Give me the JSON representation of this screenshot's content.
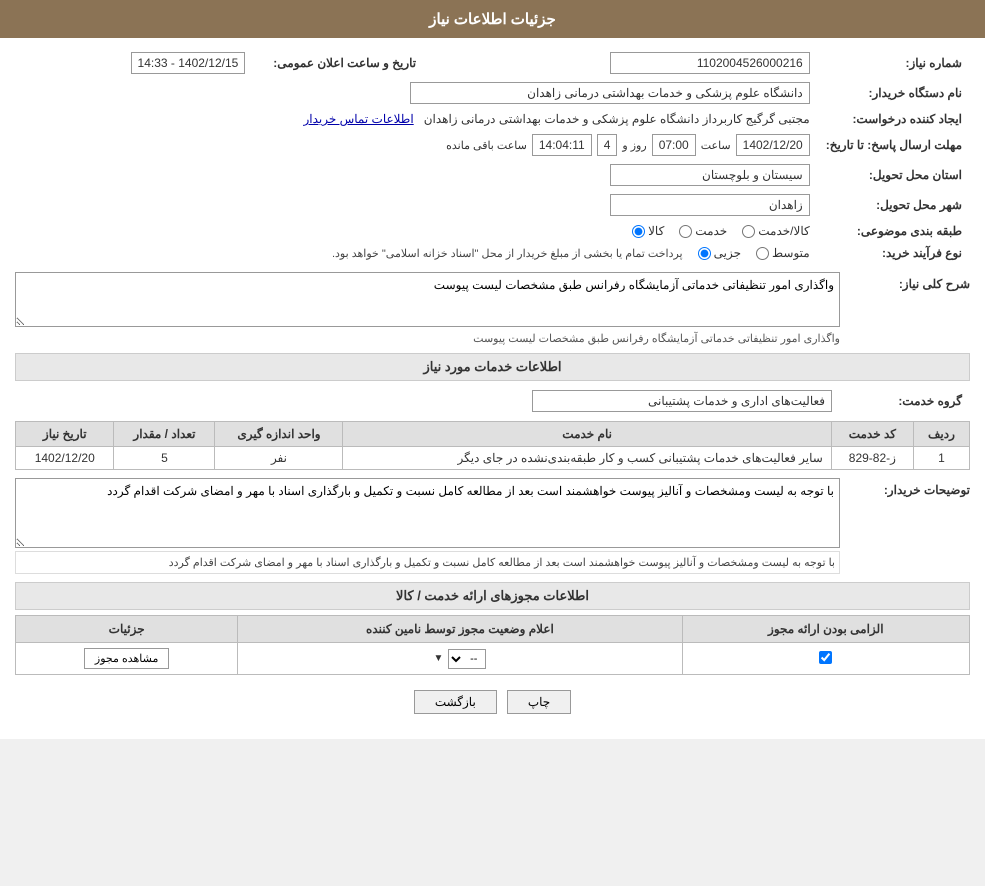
{
  "header": {
    "title": "جزئیات اطلاعات نیاز"
  },
  "labels": {
    "need_number": "شماره نیاز:",
    "buyer_org": "نام دستگاه خریدار:",
    "creator": "ایجاد کننده درخواست:",
    "send_date": "مهلت ارسال پاسخ: تا تاریخ:",
    "province": "استان محل تحویل:",
    "city": "شهر محل تحویل:",
    "category": "طبقه بندی موضوعی:",
    "purchase_type": "نوع فرآیند خرید:",
    "general_desc": "شرح کلی نیاز:",
    "service_info": "اطلاعات خدمات مورد نیاز",
    "service_group": "گروه خدمت:",
    "buyer_notes": "توضیحات خریدار:",
    "permissions_info": "اطلاعات مجوزهای ارائه خدمت / کالا",
    "announce_date": "تاریخ و ساعت اعلان عمومی:",
    "mandatory_permit": "الزامی بودن ارائه مجوز",
    "permit_status": "اعلام وضعیت مجوز توسط نامین کننده",
    "details": "جزئیات"
  },
  "values": {
    "need_number": "1102004526000216",
    "announce_date": "1402/12/15 - 14:33",
    "buyer_org": "دانشگاه علوم پزشکی و خدمات بهداشتی درمانی زاهدان",
    "creator_name": "مجتبی گرگیج کاربرداز دانشگاه علوم پزشکی و خدمات بهداشتی درمانی زاهدان",
    "creator_link": "اطلاعات تماس خریدار",
    "deadline_date": "1402/12/20",
    "deadline_time": "07:00",
    "deadline_days": "4",
    "deadline_remaining": "14:04:11",
    "province": "سیستان و بلوچستان",
    "city": "زاهدان",
    "category_kala": "کالا",
    "category_khadamat": "خدمت",
    "category_kala_khadamat": "کالا/خدمت",
    "purchase_type_jozi": "جزیی",
    "purchase_type_mottavaset": "متوسط",
    "purchase_type_note": "پرداخت تمام یا بخشی از مبلغ خریدار از محل \"اسناد خزانه اسلامی\" خواهد بود.",
    "general_desc_text": "واگذاری امور تنظیفاتی خدماتی آزمایشگاه رفرانس طبق مشخصات لیست پیوست",
    "service_group_value": "فعالیت‌های اداری و خدمات پشتیبانی",
    "row_number": "1",
    "service_code": "ز-82-829",
    "service_name": "سایر فعالیت‌های خدمات پشتیبانی کسب و کار طبقه‌بندی‌نشده در جای دیگر",
    "unit": "نفر",
    "quantity": "5",
    "service_date": "1402/12/20",
    "buyer_notes_text": "با توجه به لیست ومشخصات و آنالیز پیوست خواهشمند است بعد از مطالعه کامل نسبت و تکمیل و بارگذاری اسناد با مهر و امضای شرکت اقدام گردد",
    "permit_required_checked": true,
    "permit_status_value": "--",
    "view_permit_btn": "مشاهده مجوز",
    "btn_back": "بازگشت",
    "btn_print": "چاپ",
    "saah_label": "ساعت",
    "rooz_label": "روز و",
    "saaat_baqi": "ساعت باقی مانده"
  },
  "table": {
    "headers": {
      "col1": "ردیف",
      "col2": "کد خدمت",
      "col3": "نام خدمت",
      "col4": "واحد اندازه گیری",
      "col5": "تعداد / مقدار",
      "col6": "تاریخ نیاز"
    }
  },
  "permissions_table": {
    "headers": {
      "col1": "الزامی بودن ارائه مجوز",
      "col2": "اعلام وضعیت مجوز توسط نامین کننده",
      "col3": "جزئیات"
    }
  }
}
